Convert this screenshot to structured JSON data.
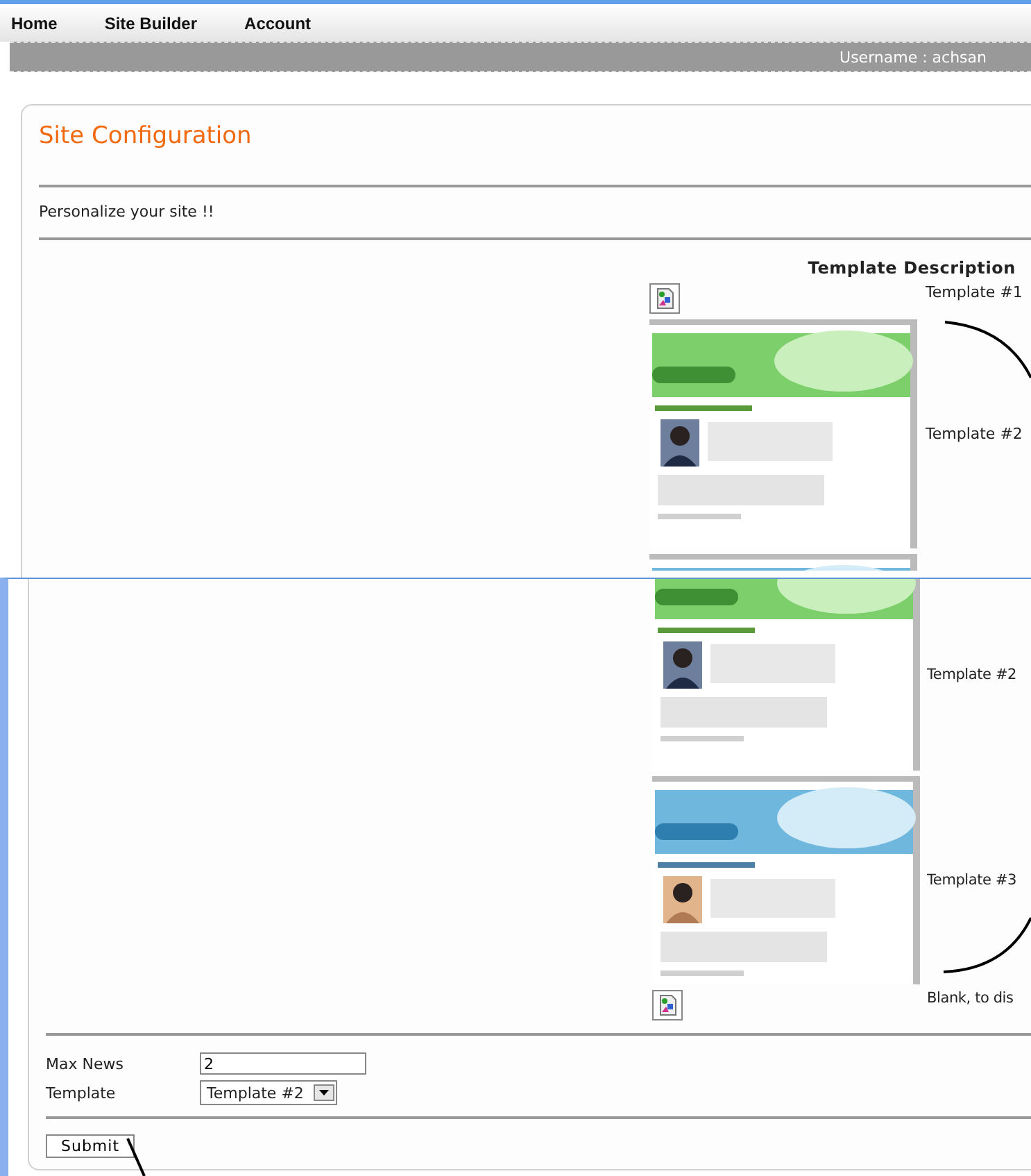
{
  "nav": {
    "items": [
      {
        "label": "Home"
      },
      {
        "label": "Site Builder"
      },
      {
        "label": "Account"
      }
    ]
  },
  "user_bar": {
    "text": "Username : achsan"
  },
  "top_capture": {
    "title": "Site Configuration",
    "intro": "Personalize your site !!",
    "heading": "Template Description",
    "rows": [
      {
        "kind": "icon",
        "label": "Template #1"
      },
      {
        "kind": "picture",
        "label": "Template #2"
      },
      {
        "kind": "picture"
      }
    ]
  },
  "bottom_capture": {
    "rows": [
      {
        "kind": "picture",
        "label": "Template #2"
      },
      {
        "kind": "picture",
        "label": "Template #3"
      },
      {
        "kind": "icon",
        "label": "Blank, to dis"
      }
    ],
    "fields": [
      {
        "label": "Max News",
        "kind": "text",
        "value": "2"
      },
      {
        "label": "Template",
        "kind": "select",
        "value": "Template #2"
      }
    ],
    "submit": "Submit"
  }
}
